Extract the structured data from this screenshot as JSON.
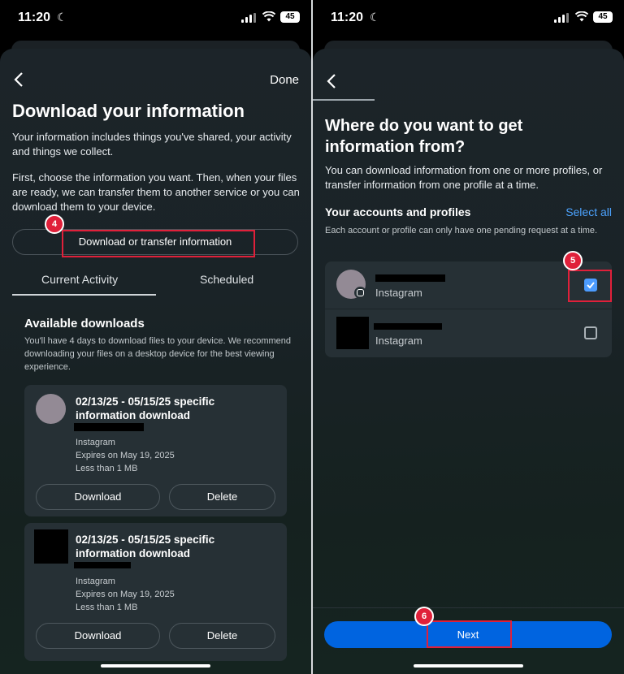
{
  "status": {
    "time": "11:20",
    "battery": "45"
  },
  "left": {
    "done_label": "Done",
    "title": "Download your information",
    "intro_1": "Your information includes things you've shared, your activity and things we collect.",
    "intro_2": "First, choose the information you want. Then, when your files are ready, we can transfer them to another service or you can download them to your device.",
    "step_badge": "4",
    "transfer_button": "Download or transfer information",
    "tabs": [
      {
        "label": "Current Activity"
      },
      {
        "label": "Scheduled"
      }
    ],
    "available_title": "Available downloads",
    "available_text": "You'll have 4 days to download files to your device. We recommend downloading your files on a desktop device for the best viewing experience.",
    "downloads": [
      {
        "title": "02/13/25 - 05/15/25 specific information download",
        "source": "Instagram",
        "expires": "Expires on May 19, 2025",
        "size": "Less than 1 MB",
        "download_label": "Download",
        "delete_label": "Delete"
      },
      {
        "title": "02/13/25 - 05/15/25 specific information download",
        "source": "Instagram",
        "expires": "Expires on May 19, 2025",
        "size": "Less than 1 MB",
        "download_label": "Download",
        "delete_label": "Delete"
      }
    ]
  },
  "right": {
    "title": "Where do you want to get information from?",
    "subtitle": "You can download information from one or more profiles, or transfer information from one profile at a time.",
    "section_title": "Your accounts and profiles",
    "select_all": "Select all",
    "section_note": "Each account or profile can only have one pending request at a time.",
    "accounts": [
      {
        "platform": "Instagram",
        "checked": true
      },
      {
        "platform": "Instagram",
        "checked": false
      }
    ],
    "step_badge_select": "5",
    "step_badge_next": "6",
    "next_label": "Next"
  },
  "colors": {
    "accent_blue": "#0064e0",
    "link_blue": "#4ca3ff",
    "highlight_red": "#e0203a"
  }
}
